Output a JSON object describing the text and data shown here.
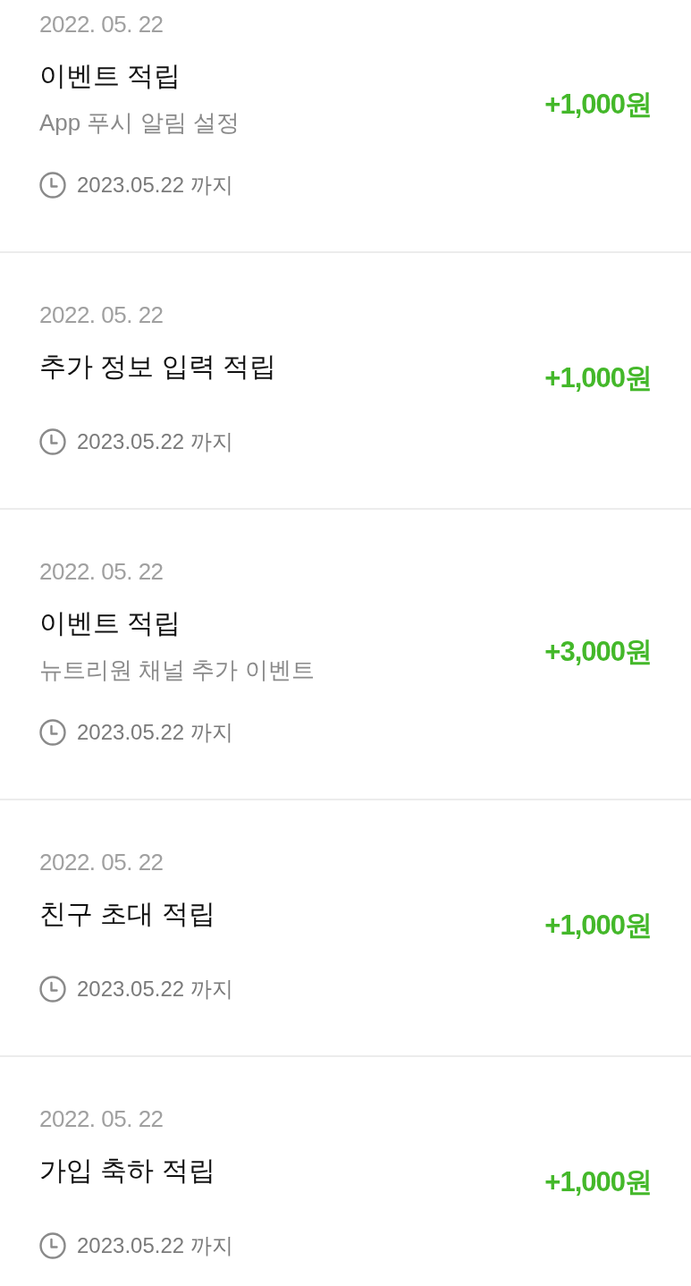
{
  "transactions": [
    {
      "date": "2022. 05. 22",
      "title": "이벤트 적립",
      "description": "App 푸시 알림 설정",
      "expiry": "2023.05.22 까지",
      "amount": "+1,000원"
    },
    {
      "date": "2022. 05. 22",
      "title": "추가 정보 입력 적립",
      "expiry": "2023.05.22 까지",
      "amount": "+1,000원"
    },
    {
      "date": "2022. 05. 22",
      "title": "이벤트 적립",
      "description": "뉴트리원 채널 추가 이벤트",
      "expiry": "2023.05.22 까지",
      "amount": "+3,000원"
    },
    {
      "date": "2022. 05. 22",
      "title": "친구 초대 적립",
      "expiry": "2023.05.22 까지",
      "amount": "+1,000원"
    },
    {
      "date": "2022. 05. 22",
      "title": "가입 축하 적립",
      "expiry": "2023.05.22 까지",
      "amount": "+1,000원"
    }
  ]
}
